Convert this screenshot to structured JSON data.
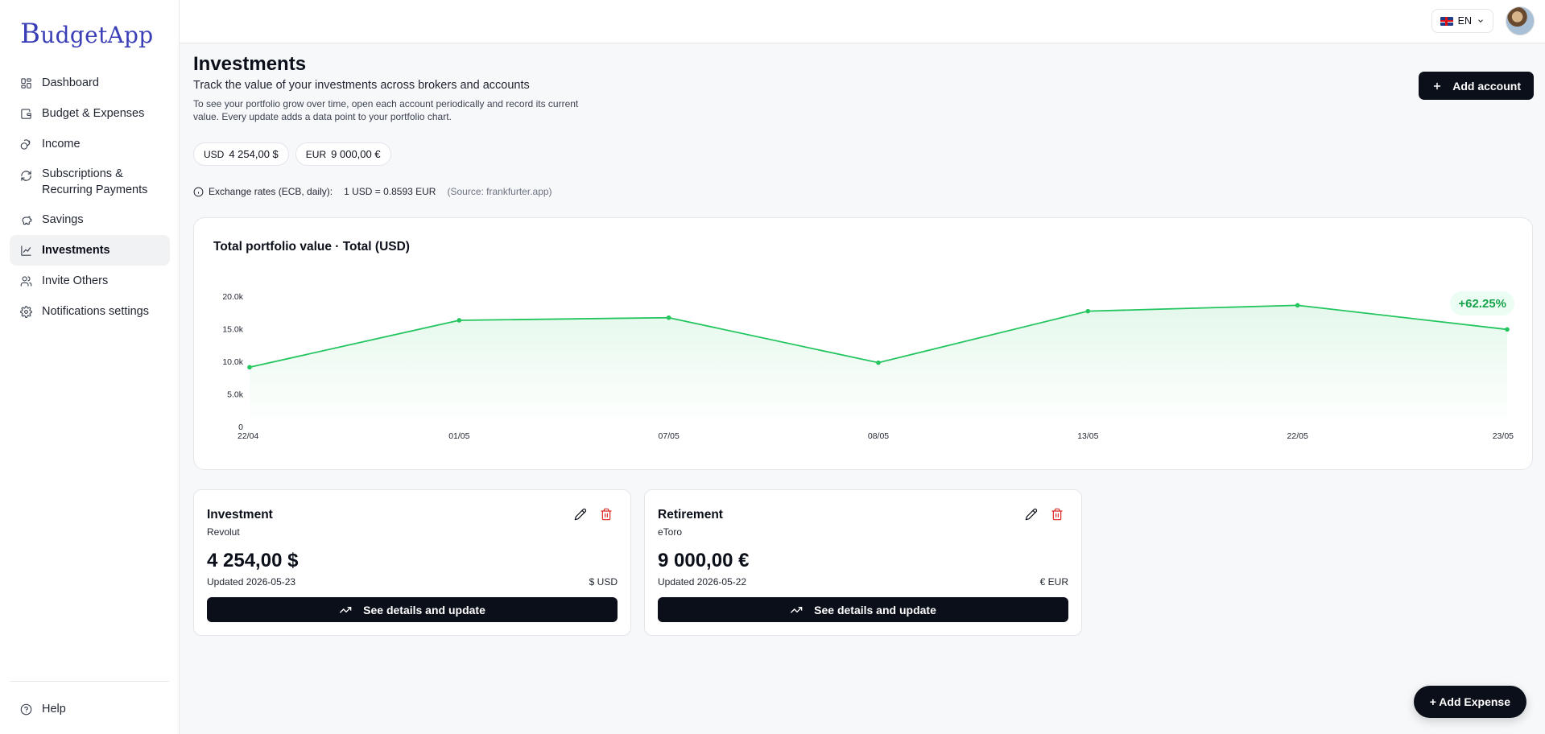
{
  "app": {
    "logo_b": "B",
    "logo_rest": "udgetApp"
  },
  "sidebar": {
    "items": [
      {
        "label": "Dashboard",
        "icon": "grid-icon"
      },
      {
        "label": "Budget & Expenses",
        "icon": "wallet-icon"
      },
      {
        "label": "Income",
        "icon": "coins-icon"
      },
      {
        "label": "Subscriptions &",
        "label2": "Recurring Payments",
        "icon": "refresh-icon"
      },
      {
        "label": "Savings",
        "icon": "piggy-bank-icon"
      },
      {
        "label": "Investments",
        "icon": "chart-line-icon",
        "active": true
      },
      {
        "label": "Invite Others",
        "icon": "users-icon"
      },
      {
        "label": "Notifications settings",
        "icon": "gear-icon"
      }
    ],
    "help": "Help"
  },
  "topbar": {
    "lang": "EN"
  },
  "header": {
    "title": "Investments",
    "subtitle": "Track the value of your investments across brokers and accounts",
    "description_line1": "To see your portfolio grow over time, open each account periodically and record its current",
    "description_line2": "value. Every update adds a data point to your portfolio chart.",
    "add_account": "Add account"
  },
  "totals": [
    {
      "currency": "USD",
      "amount": "4 254,00 $"
    },
    {
      "currency": "EUR",
      "amount": "9 000,00 €"
    }
  ],
  "rates": {
    "label": "Exchange rates (ECB, daily):",
    "value": "1 USD = 0.8593 EUR",
    "source": "(Source: frankfurter.app)"
  },
  "chart_data": {
    "type": "area",
    "title": "Total portfolio value · Total (USD)",
    "categories": [
      "22/04",
      "01/05",
      "07/05",
      "08/05",
      "13/05",
      "22/05",
      "23/05"
    ],
    "values": [
      9100,
      16300,
      16700,
      9800,
      17700,
      18600,
      14900
    ],
    "y_ticks": [
      "0",
      "5.0k",
      "10.0k",
      "15.0k",
      "20.0k"
    ],
    "ylim": [
      0,
      20000
    ],
    "change_badge": "+62.25%",
    "color": "#22c55e"
  },
  "accounts": [
    {
      "name": "Investment",
      "broker": "Revolut",
      "value": "4 254,00 $",
      "updated": "Updated 2026-05-23",
      "currency": "$ USD",
      "action": "See details and update"
    },
    {
      "name": "Retirement",
      "broker": "eToro",
      "value": "9 000,00 €",
      "updated": "Updated 2026-05-22",
      "currency": "€ EUR",
      "action": "See details and update"
    }
  ],
  "fab": {
    "label": "+ Add Expense"
  }
}
